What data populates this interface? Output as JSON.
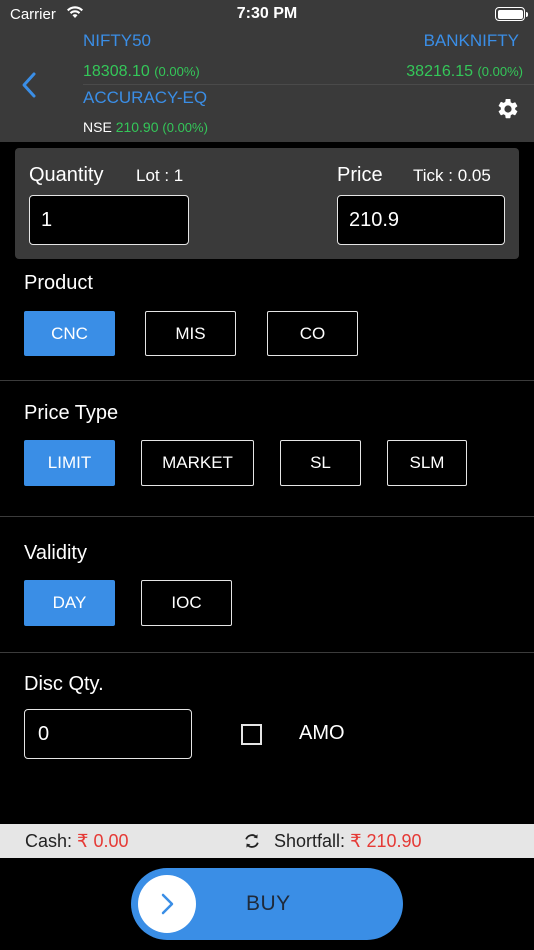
{
  "status_bar": {
    "carrier": "Carrier",
    "time": "7:30 PM"
  },
  "header": {
    "index1": {
      "name": "NIFTY50",
      "value": "18308.10",
      "change": "(0.00%)"
    },
    "index2": {
      "name": "BANKNIFTY",
      "value": "38216.15",
      "change": "(0.00%)"
    },
    "symbol": "ACCURACY-EQ",
    "exchange": "NSE",
    "price": "210.90",
    "change": "(0.00%)"
  },
  "order": {
    "quantity_label": "Quantity",
    "lot_label": "Lot : 1",
    "quantity_value": "1",
    "price_label": "Price",
    "tick_label": "Tick : 0.05",
    "price_value": "210.9"
  },
  "product": {
    "title": "Product",
    "options": [
      "CNC",
      "MIS",
      "CO"
    ],
    "selected": "CNC"
  },
  "price_type": {
    "title": "Price Type",
    "options": [
      "LIMIT",
      "MARKET",
      "SL",
      "SLM"
    ],
    "selected": "LIMIT"
  },
  "validity": {
    "title": "Validity",
    "options": [
      "DAY",
      "IOC"
    ],
    "selected": "DAY"
  },
  "disc_qty": {
    "title": "Disc Qty.",
    "value": "0",
    "amo_label": "AMO",
    "amo_checked": false
  },
  "footer": {
    "cash_label": "Cash:",
    "cash_value": "₹ 0.00",
    "shortfall_label": "Shortfall:",
    "shortfall_value": "₹ 210.90",
    "buy_label": "BUY"
  },
  "colors": {
    "accent": "#3a8ee6",
    "positive": "#34c759",
    "negative": "#e53935",
    "header_bg": "#3a3a3a"
  }
}
